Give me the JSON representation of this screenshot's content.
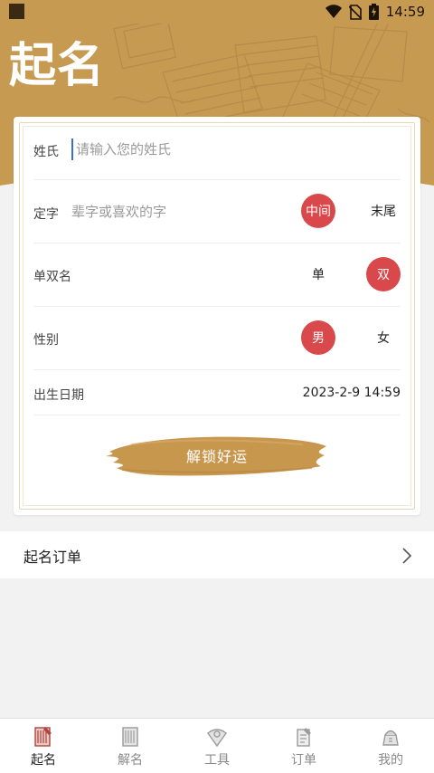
{
  "status_bar": {
    "time": "14:59"
  },
  "header": {
    "title": "起名"
  },
  "form": {
    "surname": {
      "label": "姓氏",
      "placeholder": "请输入您的姓氏",
      "value": ""
    },
    "fixed_char": {
      "label": "定字",
      "placeholder": "辈字或喜欢的字",
      "options": [
        {
          "label": "中间",
          "selected": true
        },
        {
          "label": "末尾",
          "selected": false
        }
      ]
    },
    "name_length": {
      "label": "单双名",
      "options": [
        {
          "label": "单",
          "selected": false
        },
        {
          "label": "双",
          "selected": true
        }
      ]
    },
    "gender": {
      "label": "性别",
      "options": [
        {
          "label": "男",
          "selected": true
        },
        {
          "label": "女",
          "selected": false
        }
      ]
    },
    "birth": {
      "label": "出生日期",
      "value": "2023-2-9 14:59"
    },
    "submit_label": "解锁好运"
  },
  "orders": {
    "label": "起名订单"
  },
  "nav": {
    "items": [
      {
        "label": "起名",
        "icon": "naming-book-icon",
        "active": true
      },
      {
        "label": "解名",
        "icon": "scroll-icon",
        "active": false
      },
      {
        "label": "工具",
        "icon": "compass-fan-icon",
        "active": false
      },
      {
        "label": "订单",
        "icon": "order-scroll-icon",
        "active": false
      },
      {
        "label": "我的",
        "icon": "profile-icon",
        "active": false
      }
    ]
  },
  "colors": {
    "header_gold": "#c79a52",
    "brush_gold": "#c8974e",
    "selected_red": "#d9484a",
    "cursor_blue": "#3d6bd6"
  }
}
